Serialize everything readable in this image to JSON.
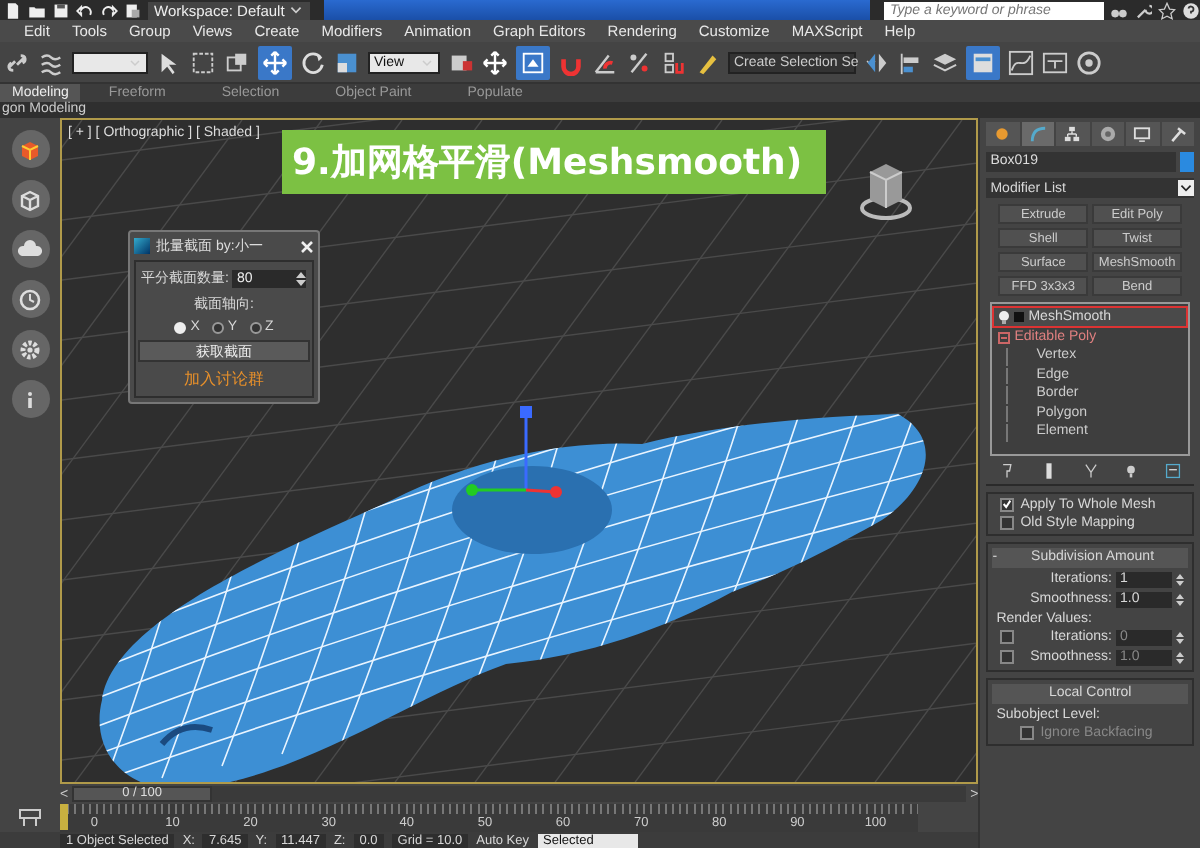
{
  "title_bar": {
    "workspace": "Workspace: Default",
    "search": {
      "placeholder": "Type a keyword or phrase"
    }
  },
  "menu": [
    "Edit",
    "Tools",
    "Group",
    "Views",
    "Create",
    "Modifiers",
    "Animation",
    "Graph Editors",
    "Rendering",
    "Customize",
    "MAXScript",
    "Help"
  ],
  "toolbar": {
    "view_dropdown": "View",
    "selection_set": "Create Selection Se"
  },
  "ribbon": {
    "tabs": [
      {
        "label": "Modeling",
        "selected": true
      },
      {
        "label": "Freeform",
        "selected": false
      },
      {
        "label": "Selection",
        "selected": false
      },
      {
        "label": "Object Paint",
        "selected": false
      },
      {
        "label": "Populate",
        "selected": false
      }
    ],
    "panel_title": "gon Modeling"
  },
  "viewport": {
    "label": "[ + ] [ Orthographic ] [ Shaded ]",
    "banner": "9.加网格平滑(Meshsmooth)",
    "dialog": {
      "title": "批量截面 by:小一",
      "count_label": "平分截面数量:",
      "count_value": "80",
      "axis_label": "截面轴向:",
      "axes": [
        {
          "label": "X",
          "selected": true
        },
        {
          "label": "Y",
          "selected": false
        },
        {
          "label": "Z",
          "selected": false
        }
      ],
      "button": "获取截面",
      "link": "加入讨论群"
    }
  },
  "command_panel": {
    "tabs": [
      {
        "selected": false
      },
      {
        "selected": true
      },
      {
        "selected": false
      },
      {
        "selected": false
      },
      {
        "selected": false
      },
      {
        "selected": false
      }
    ],
    "object_name": "Box019",
    "modifier_list": "Modifier List",
    "modifier_buttons": [
      "Extrude",
      "Edit Poly",
      "Shell",
      "Twist",
      "Surface",
      "MeshSmooth",
      "FFD 3x3x3",
      "Bend"
    ],
    "stack": [
      {
        "label": "MeshSmooth",
        "selected": true
      },
      {
        "label": "Editable Poly",
        "selected": false,
        "expanded": true,
        "children": [
          {
            "label": "Vertex",
            "selected": false
          },
          {
            "label": "Edge",
            "selected": false
          },
          {
            "label": "Border",
            "selected": false
          },
          {
            "label": "Polygon",
            "selected": false
          },
          {
            "label": "Element",
            "selected": false
          }
        ]
      }
    ],
    "options": [
      {
        "label": "Apply To Whole Mesh",
        "checked": true
      },
      {
        "label": "Old Style Mapping",
        "checked": false
      }
    ],
    "subdivision": {
      "title": "Subdivision Amount",
      "collapse": "-",
      "fields": [
        {
          "label": "Iterations:",
          "value": "1"
        },
        {
          "label": "Smoothness:",
          "value": "1.0"
        }
      ],
      "render_values_label": "Render Values:",
      "render_fields": [
        {
          "label": "Iterations:",
          "value": "0",
          "checked": false,
          "disabled": true
        },
        {
          "label": "Smoothness:",
          "value": "1.0",
          "checked": false,
          "disabled": true
        }
      ]
    },
    "local_control": {
      "title": "Local Control",
      "subobject_label": "Subobject Level:",
      "ignore_backfacing": {
        "label": "Ignore Backfacing",
        "checked": false,
        "disabled": true
      }
    }
  },
  "timeline": {
    "previous": "<",
    "next": ">",
    "position": "0 / 100",
    "level": 0,
    "ticks": [
      "0",
      "10",
      "20",
      "30",
      "40",
      "50",
      "60",
      "70",
      "80",
      "90",
      "100"
    ]
  },
  "status_bar": {
    "selection": "1 Object Selected",
    "coords": [
      {
        "axis": "X:",
        "value": "7.645"
      },
      {
        "axis": "Y:",
        "value": "11.447"
      },
      {
        "axis": "Z:",
        "value": "0.0"
      }
    ],
    "grid": "Grid = 10.0",
    "auto_key": "Auto Key",
    "key_filter": "Selected"
  }
}
